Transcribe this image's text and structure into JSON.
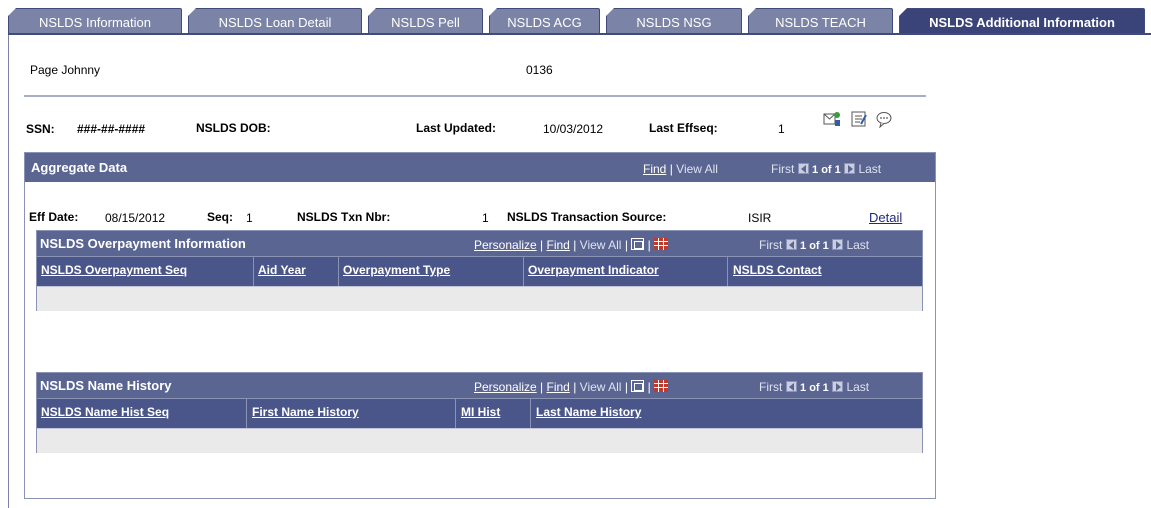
{
  "tabs": [
    {
      "label": "NSLDS Information",
      "active": false
    },
    {
      "label": "NSLDS Loan Detail",
      "active": false
    },
    {
      "label": "NSLDS Pell",
      "active": false
    },
    {
      "label": "NSLDS ACG",
      "active": false
    },
    {
      "label": "NSLDS NSG",
      "active": false
    },
    {
      "label": "NSLDS TEACH",
      "active": false
    },
    {
      "label": "NSLDS Additional Information",
      "active": true
    }
  ],
  "header": {
    "name": "Page Johnny",
    "id": "0136",
    "ssn_label": "SSN:",
    "ssn_value": "###-##-####",
    "dob_label": "NSLDS DOB:",
    "last_updated_label": "Last Updated:",
    "last_updated_value": "10/03/2012",
    "last_effseq_label": "Last Effseq:",
    "last_effseq_value": "1"
  },
  "aggregate": {
    "title": "Aggregate Data",
    "find": "Find",
    "sep": "|",
    "view_all": "View All",
    "first": "First",
    "counter": "1 of 1",
    "last": "Last",
    "eff_date_label": "Eff Date:",
    "eff_date_value": "08/15/2012",
    "seq_label": "Seq:",
    "seq_value": "1",
    "txn_label": "NSLDS Txn Nbr:",
    "txn_value": "1",
    "source_label": "NSLDS Transaction Source:",
    "source_value": "ISIR",
    "detail_link": "Detail"
  },
  "overpayment": {
    "title": "NSLDS Overpayment Information",
    "personalize": "Personalize",
    "find": "Find",
    "sep": "|",
    "view_all": "View All",
    "first": "First",
    "counter": "1 of 1",
    "last": "Last",
    "columns": [
      "NSLDS Overpayment Seq",
      "Aid Year",
      "Overpayment Type",
      "Overpayment Indicator",
      "NSLDS Contact"
    ]
  },
  "name_history": {
    "title": "NSLDS Name History",
    "personalize": "Personalize",
    "find": "Find",
    "sep": "|",
    "view_all": "View All",
    "first": "First",
    "counter": "1 of 1",
    "last": "Last",
    "columns": [
      "NSLDS Name Hist Seq",
      "First Name History",
      "MI Hist",
      "Last Name History"
    ]
  },
  "icons": [
    "notify-icon",
    "notepad-icon",
    "comment-icon"
  ],
  "colors": {
    "tab_bg": "#7b84a6",
    "tab_active": "#3a4478",
    "grid_header": "#5a6592",
    "link": "#222a7a"
  }
}
